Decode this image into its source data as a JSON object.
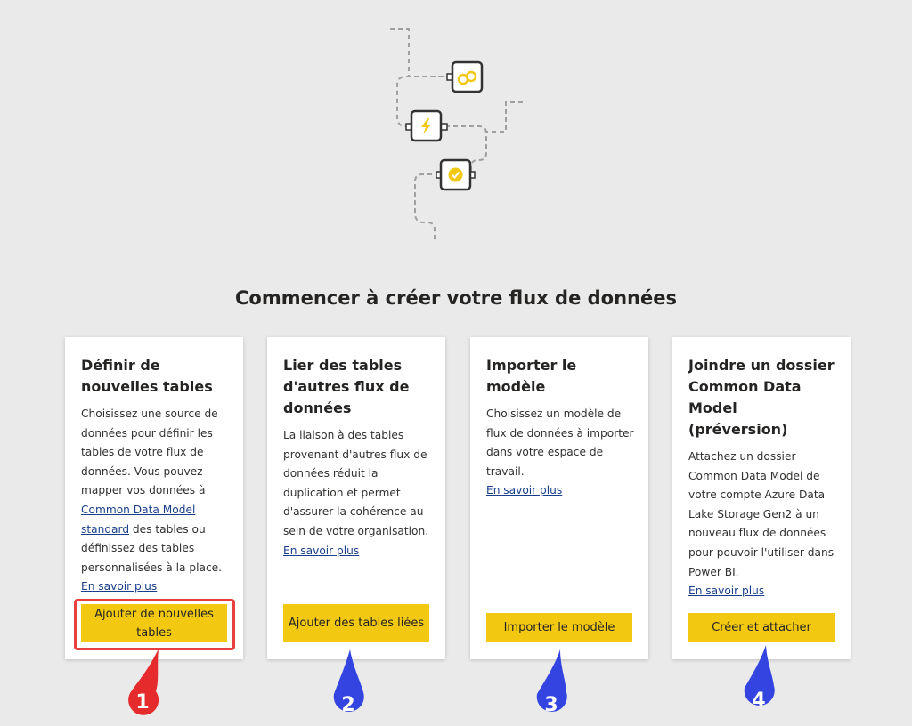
{
  "page": {
    "title": "Commencer à créer votre flux de données"
  },
  "illustration": {
    "icons": [
      "link-icon",
      "lightning-bolt-icon",
      "verified-check-icon"
    ],
    "accent_color": "#f2c811"
  },
  "cards": [
    {
      "title": "Définir de nouvelles tables",
      "desc_before": "Choisissez une source de données pour définir les tables de votre flux de données. Vous pouvez mapper vos données à ",
      "desc_link": "Common Data Model standard",
      "desc_after": " des tables ou définissez des tables personnalisées à la place.",
      "learn_more": "En savoir plus",
      "button": "Ajouter de nouvelles tables"
    },
    {
      "title": "Lier des tables d'autres flux de données",
      "desc": "La liaison à des tables provenant d'autres flux de données réduit la duplication et permet d'assurer la cohérence au sein de votre organisation.",
      "learn_more": "En savoir plus",
      "button": "Ajouter des tables liées"
    },
    {
      "title": "Importer le modèle",
      "desc": "Choisissez un modèle de flux de données à importer dans votre espace de travail.",
      "learn_more": "En savoir plus",
      "button": "Importer le modèle"
    },
    {
      "title": "Joindre un dossier Common Data Model (préversion)",
      "desc": "Attachez un dossier Common Data Model de votre compte Azure Data Lake Storage Gen2 à un nouveau flux de données pour pouvoir l'utiliser dans Power BI.",
      "learn_more": "En savoir plus",
      "button": "Créer et attacher"
    }
  ],
  "markers": [
    {
      "label": "1",
      "color": "#e52b2b"
    },
    {
      "label": "2",
      "color": "#3344e0"
    },
    {
      "label": "3",
      "color": "#3344e0"
    },
    {
      "label": "4",
      "color": "#3344e0"
    }
  ],
  "highlight_color": "#e8403f"
}
